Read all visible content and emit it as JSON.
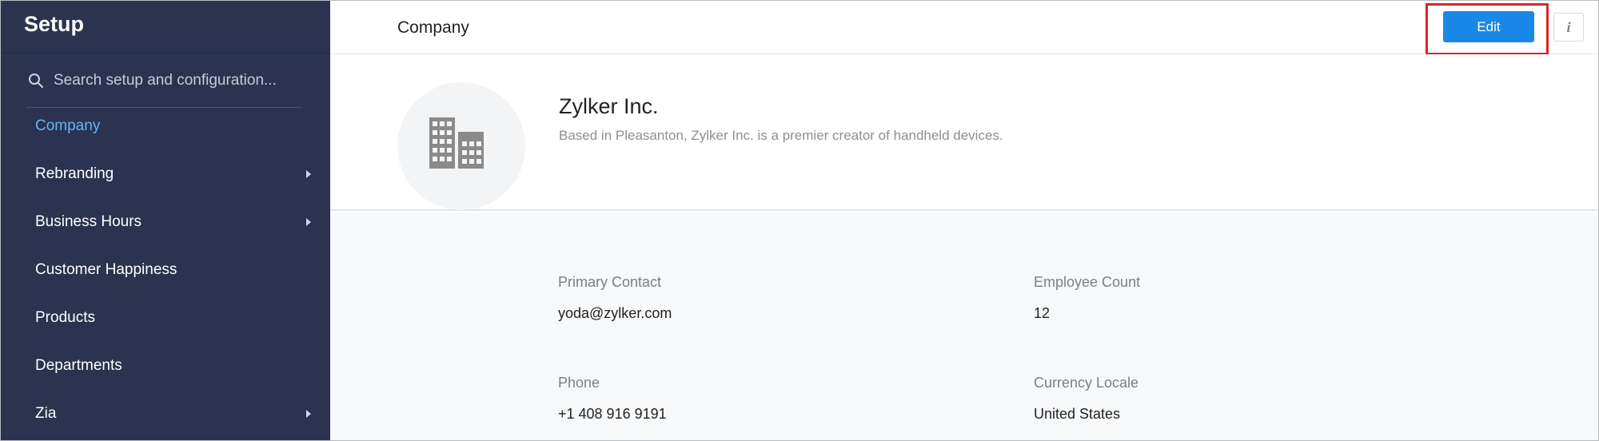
{
  "sidebar": {
    "title": "Setup",
    "search_placeholder": "Search setup and configuration...",
    "items": [
      {
        "label": "Company",
        "active": true,
        "has_submenu": false
      },
      {
        "label": "Rebranding",
        "active": false,
        "has_submenu": true
      },
      {
        "label": "Business Hours",
        "active": false,
        "has_submenu": true
      },
      {
        "label": "Customer Happiness",
        "active": false,
        "has_submenu": false
      },
      {
        "label": "Products",
        "active": false,
        "has_submenu": false
      },
      {
        "label": "Departments",
        "active": false,
        "has_submenu": false
      },
      {
        "label": "Zia",
        "active": false,
        "has_submenu": true
      }
    ]
  },
  "header": {
    "title": "Company",
    "edit_label": "Edit",
    "info_label": "i"
  },
  "company": {
    "name": "Zylker Inc.",
    "description": "Based in Pleasanton, Zylker Inc. is a premier creator of handheld devices.",
    "logo_icon": "building-icon"
  },
  "details": {
    "primary_contact_label": "Primary Contact",
    "primary_contact_value": "yoda@zylker.com",
    "employee_count_label": "Employee Count",
    "employee_count_value": "12",
    "phone_label": "Phone",
    "phone_value": "+1 408 916 9191",
    "currency_locale_label": "Currency Locale",
    "currency_locale_value": "United States"
  },
  "colors": {
    "sidebar_bg": "#2b3350",
    "active_item": "#5fb5f6",
    "edit_button": "#1a88e6",
    "highlight_box": "#d9262b"
  }
}
